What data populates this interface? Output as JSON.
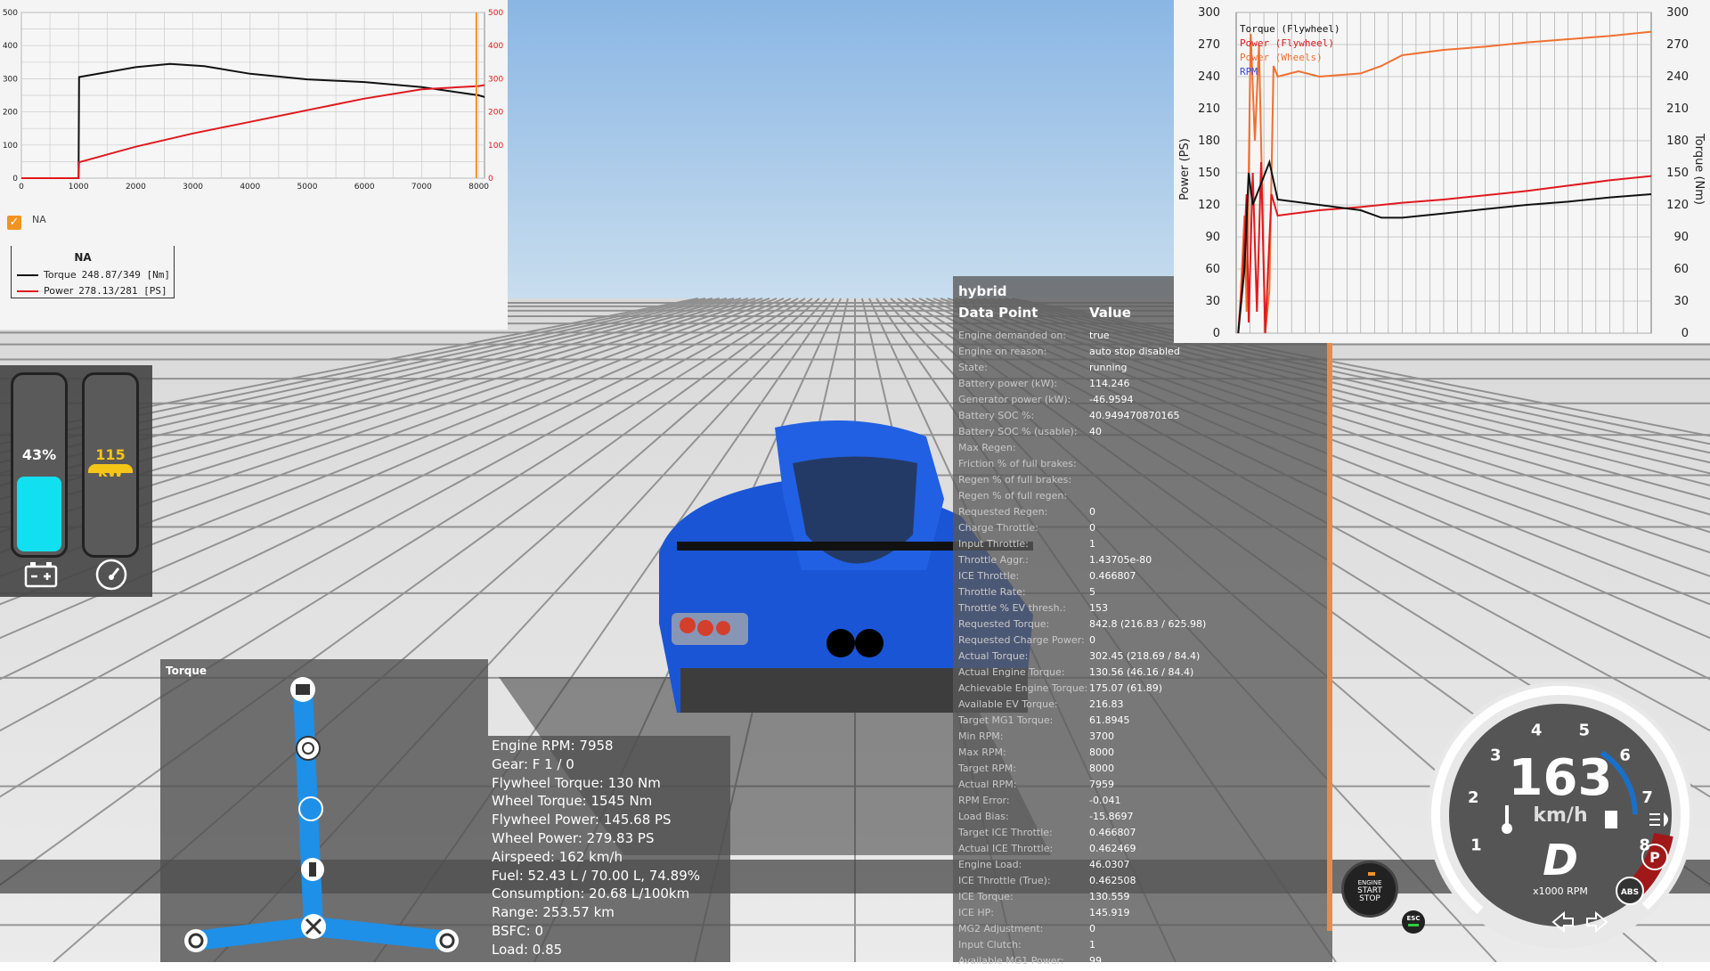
{
  "dyno_left": {
    "x_ticks": [
      "0",
      "1000",
      "2000",
      "3000",
      "4000",
      "5000",
      "6000",
      "7000",
      "8000"
    ],
    "y_ticks_left": [
      "0",
      "100",
      "200",
      "300",
      "400",
      "500"
    ],
    "y_ticks_right": [
      "0",
      "100",
      "200",
      "300",
      "400",
      "500"
    ],
    "na_label": "NA",
    "legend_title": "NA",
    "torque_label": "Torque",
    "torque_value": "248.87/349 [Nm]",
    "power_label": "Power",
    "power_value": "278.13/281 [PS]",
    "torque_color": "#111111",
    "power_color": "#e0191e",
    "cursor_color": "#f29322"
  },
  "battery": {
    "soc_label": "43%",
    "soc_fraction": 0.43,
    "power_label": "115 kW",
    "power_fraction": 0.45,
    "soc_color": "#12e0f0",
    "power_color": "#f5c518",
    "battery_icon": "battery-icon",
    "gauge_icon": "speedometer-icon"
  },
  "hybrid": {
    "title": "hybrid",
    "col_key": "Data Point",
    "col_value": "Value",
    "rows": [
      {
        "k": "Engine demanded on:",
        "v": "true"
      },
      {
        "k": "Engine on reason:",
        "v": "auto stop disabled"
      },
      {
        "k": "State:",
        "v": "running"
      },
      {
        "k": "Battery power (kW):",
        "v": "114.246"
      },
      {
        "k": "Generator power (kW):",
        "v": "-46.9594"
      },
      {
        "k": "Battery SOC %:",
        "v": "40.949470870165"
      },
      {
        "k": "Battery SOC % (usable):",
        "v": "40"
      },
      {
        "k": "Max Regen:",
        "v": ""
      },
      {
        "k": "Friction % of full brakes:",
        "v": ""
      },
      {
        "k": "Regen % of full brakes:",
        "v": ""
      },
      {
        "k": "Regen % of full regen:",
        "v": ""
      },
      {
        "k": "Requested Regen:",
        "v": "0"
      },
      {
        "k": "Charge Throttle:",
        "v": "0"
      },
      {
        "k": "Input Throttle:",
        "v": "1"
      },
      {
        "k": "Throttle Aggr.:",
        "v": "1.43705e-80"
      },
      {
        "k": "ICE Throttle:",
        "v": "0.466807"
      },
      {
        "k": "Throttle Rate:",
        "v": "5"
      },
      {
        "k": "Throttle % EV thresh.:",
        "v": "153"
      },
      {
        "k": "Requested Torque:",
        "v": "842.8 (216.83 / 625.98)"
      },
      {
        "k": "Requested Charge Power:",
        "v": "0"
      },
      {
        "k": "Actual Torque:",
        "v": "302.45 (218.69 / 84.4)"
      },
      {
        "k": "Actual Engine Torque:",
        "v": "130.56 (46.16 / 84.4)"
      },
      {
        "k": "Achievable Engine Torque:",
        "v": "175.07 (61.89)"
      },
      {
        "k": "Available EV Torque:",
        "v": "216.83"
      },
      {
        "k": "Target MG1 Torque:",
        "v": "61.8945"
      },
      {
        "k": "Min RPM:",
        "v": "3700"
      },
      {
        "k": "Max RPM:",
        "v": "8000"
      },
      {
        "k": "Target RPM:",
        "v": "8000"
      },
      {
        "k": "Actual RPM:",
        "v": "7959"
      },
      {
        "k": "RPM Error:",
        "v": "-0.041"
      },
      {
        "k": "Load Bias:",
        "v": "-15.8697"
      },
      {
        "k": "Target ICE Throttle:",
        "v": "0.466807"
      },
      {
        "k": "Actual ICE Throttle:",
        "v": "0.462469"
      },
      {
        "k": "Engine Load:",
        "v": "46.0307"
      },
      {
        "k": "ICE Throttle (True):",
        "v": "0.462508"
      },
      {
        "k": "ICE Torque:",
        "v": "130.559"
      },
      {
        "k": "ICE HP:",
        "v": "145.919"
      },
      {
        "k": "MG2 Adjustment:",
        "v": "0"
      },
      {
        "k": "Input Clutch:",
        "v": "1"
      },
      {
        "k": "Available MG1 Power:",
        "v": "99"
      }
    ]
  },
  "dyno_right": {
    "y_ticks": [
      "0",
      "30",
      "60",
      "90",
      "120",
      "150",
      "180",
      "210",
      "240",
      "270",
      "300"
    ],
    "left_axis_label": "Power (PS)",
    "right_axis_label": "Torque (Nm)",
    "legend": [
      {
        "name": "Torque (Flywheel)",
        "color": "#111111"
      },
      {
        "name": "Power (Flywheel)",
        "color": "#e0191e"
      },
      {
        "name": "Power (Wheels)",
        "color": "#f07030"
      },
      {
        "name": "RPM",
        "color": "#3a4ad8"
      }
    ]
  },
  "torque_panel": {
    "title": "Torque",
    "line_color": "#1e90e8"
  },
  "engine": {
    "rows": [
      "Engine RPM: 7958",
      "Gear: F 1 / 0",
      "Flywheel Torque: 130 Nm",
      "Wheel Torque: 1545 Nm",
      "Flywheel Power: 145.68 PS",
      "Wheel Power: 279.83 PS",
      "Airspeed: 162 km/h",
      "Fuel: 52.43 L / 70.00 L, 74.89%",
      "Consumption: 20.68 L/100km",
      "Range: 253.57 km",
      "BSFC: 0",
      "Load: 0.85"
    ]
  },
  "dash": {
    "speed": "163",
    "unit": "km/h",
    "gear": "D",
    "rpm_label": "x1000 RPM",
    "rpm_ticks": [
      "1",
      "2",
      "3",
      "4",
      "5",
      "6",
      "7",
      "8"
    ],
    "rpm_fraction": 0.99,
    "start_button_line1": "ENGINE",
    "start_button_line2": "START",
    "start_button_line3": "STOP",
    "esc_label": "ESC",
    "park_label": "P",
    "abs_label": "ABS"
  }
}
